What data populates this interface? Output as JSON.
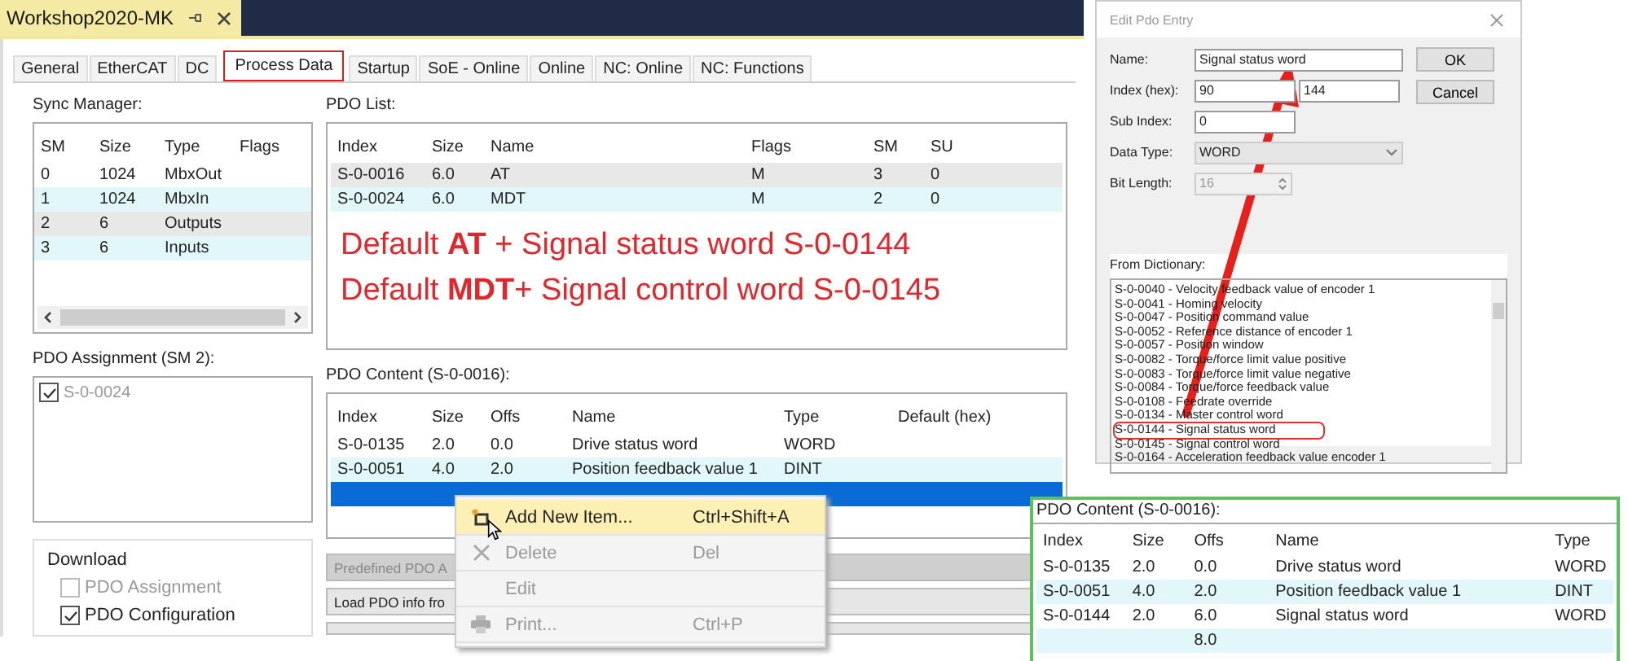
{
  "document_tab": {
    "title": "Workshop2020-MK"
  },
  "tabs": [
    {
      "label": "General",
      "selected": false
    },
    {
      "label": "EtherCAT",
      "selected": false
    },
    {
      "label": "DC",
      "selected": false
    },
    {
      "label": "Process Data",
      "selected": true
    },
    {
      "label": "Startup",
      "selected": false
    },
    {
      "label": "SoE - Online",
      "selected": false
    },
    {
      "label": "Online",
      "selected": false
    },
    {
      "label": "NC: Online",
      "selected": false
    },
    {
      "label": "NC: Functions",
      "selected": false
    }
  ],
  "sync_manager": {
    "label": "Sync Manager:",
    "columns": [
      "SM",
      "Size",
      "Type",
      "Flags"
    ],
    "rows": [
      {
        "cells": [
          "0",
          "1024",
          "MbxOut"
        ],
        "selected": false
      },
      {
        "cells": [
          "1",
          "1024",
          "MbxIn"
        ],
        "selected": false
      },
      {
        "cells": [
          "2",
          "6",
          "Outputs"
        ],
        "selected": true
      },
      {
        "cells": [
          "3",
          "6",
          "Inputs"
        ],
        "selected": false
      }
    ]
  },
  "pdo_list": {
    "label": "PDO List:",
    "columns": [
      "Index",
      "Size",
      "Name",
      "Flags",
      "SM",
      "SU"
    ],
    "rows": [
      {
        "cells": [
          "S-0-0016",
          "6.0",
          "AT",
          "M",
          "3",
          "0"
        ],
        "selected": true
      },
      {
        "cells": [
          "S-0-0024",
          "6.0",
          "MDT",
          "M",
          "2",
          "0"
        ],
        "selected": false
      }
    ],
    "annotations": [
      "Default **AT** + Signal status word S-0-0144",
      "Default **MDT**+ Signal control word S-0-0145"
    ]
  },
  "pdo_assignment": {
    "label": "PDO Assignment (SM 2):",
    "items": [
      {
        "label": "S-0-0024",
        "checked": true
      }
    ]
  },
  "pdo_content": {
    "label": "PDO Content (S-0-0016):",
    "columns": [
      "Index",
      "Size",
      "Offs",
      "Name",
      "Type",
      "Default (hex)"
    ],
    "rows": [
      {
        "cells": [
          "S-0-0135",
          "2.0",
          "0.0",
          "Drive status word",
          "WORD"
        ],
        "selected": false
      },
      {
        "cells": [
          "S-0-0051",
          "4.0",
          "2.0",
          "Position feedback value 1",
          "DINT"
        ],
        "selected": false
      }
    ],
    "new_row": {
      "selected": true
    }
  },
  "buttons": [
    {
      "label": "Predefined PDO A",
      "disabled": true
    },
    {
      "label": "Load PDO info fro",
      "disabled": false
    }
  ],
  "download": {
    "label": "Download",
    "options": [
      {
        "label": "PDO Assignment",
        "checked": false,
        "disabled": true
      },
      {
        "label": "PDO Configuration",
        "checked": true,
        "disabled": false
      }
    ]
  },
  "context_menu": {
    "items": [
      {
        "kind": "add",
        "label": "Add New Item...",
        "shortcut": "Ctrl+Shift+A",
        "highlighted": true,
        "disabled": false
      },
      {
        "kind": "delete",
        "label": "Delete",
        "shortcut": "Del",
        "highlighted": false,
        "disabled": true
      },
      {
        "kind": "plain",
        "label": "Edit",
        "highlighted": false,
        "disabled": true
      },
      {
        "kind": "print",
        "label": "Print...",
        "shortcut": "Ctrl+P",
        "highlighted": false,
        "disabled": true
      }
    ]
  },
  "dialog": {
    "title": "Edit Pdo Entry",
    "name_label": "Name:",
    "name_value": "Signal status word",
    "index_label": "Index (hex):",
    "index_value": "90",
    "index_sub_value": "144",
    "subindex_label": "Sub Index:",
    "subindex_value": "0",
    "datatype_label": "Data Type:",
    "datatype_value": "WORD",
    "bitlength_label": "Bit Length:",
    "bitlength_value": "16",
    "ok": "OK",
    "cancel": "Cancel",
    "dictionary_label": "From Dictionary:",
    "dictionary": [
      {
        "label": "S-0-0040 - Velocity feedback value of encoder 1",
        "marked": false
      },
      {
        "label": "S-0-0041 - Homing velocity",
        "marked": false
      },
      {
        "label": "S-0-0047 - Position command value",
        "marked": false
      },
      {
        "label": "S-0-0052 - Reference distance of encoder 1",
        "marked": false
      },
      {
        "label": "S-0-0057 - Position window",
        "marked": false
      },
      {
        "label": "S-0-0082 - Torque/force limit value positive",
        "marked": false
      },
      {
        "label": "S-0-0083 - Torque/force limit value negative",
        "marked": false
      },
      {
        "label": "S-0-0084 - Torque/force feedback value",
        "marked": false
      },
      {
        "label": "S-0-0108 - Feedrate override",
        "marked": false
      },
      {
        "label": "S-0-0134 - Master control word",
        "marked": false
      },
      {
        "label": "S-0-0144 - Signal status word",
        "marked": true
      },
      {
        "label": "S-0-0145 - Signal control word",
        "marked": false
      },
      {
        "label": "S-0-0164 - Acceleration feedback value encoder 1",
        "marked": false
      }
    ]
  },
  "inset": {
    "label": "PDO Content (S-0-0016):",
    "columns": [
      "Index",
      "Size",
      "Offs",
      "Name",
      "Type"
    ],
    "rows": [
      {
        "cells": [
          "S-0-0135",
          "2.0",
          "0.0",
          "Drive status word",
          "WORD"
        ]
      },
      {
        "cells": [
          "S-0-0051",
          "4.0",
          "2.0",
          "Position feedback value 1",
          "DINT"
        ]
      },
      {
        "cells": [
          "S-0-0144",
          "2.0",
          "6.0",
          "Signal status word",
          "WORD"
        ]
      },
      {
        "cells": [
          "",
          "",
          "8.0",
          "",
          ""
        ]
      }
    ]
  }
}
